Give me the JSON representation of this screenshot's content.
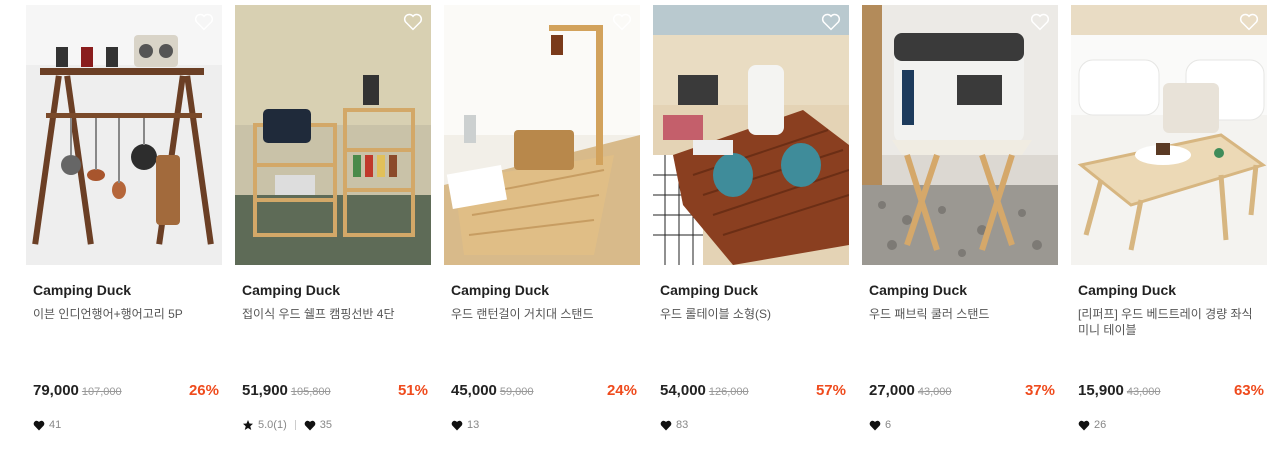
{
  "products": [
    {
      "brand": "Camping Duck",
      "title": "이븐 인디언행어+행어고리 5P",
      "price": "79,000",
      "original_price": "107,000",
      "discount": "26%",
      "likes": "41",
      "rating": null,
      "image": "wood-hanger-rack-with-lanterns-and-cookware"
    },
    {
      "brand": "Camping Duck",
      "title": "접이식 우드 쉘프 캠핑선반 4단",
      "price": "51,900",
      "original_price": "105,800",
      "discount": "51%",
      "likes": "35",
      "rating": "5.0(1)",
      "image": "folding-wood-shelves-outdoors"
    },
    {
      "brand": "Camping Duck",
      "title": "우드 랜턴걸이 거치대 스탠드",
      "price": "45,000",
      "original_price": "59,000",
      "discount": "24%",
      "likes": "13",
      "rating": null,
      "image": "wood-lantern-stand-on-table"
    },
    {
      "brand": "Camping Duck",
      "title": "우드 롤테이블 소형(S)",
      "price": "54,000",
      "original_price": "126,000",
      "discount": "57%",
      "likes": "83",
      "rating": null,
      "image": "wood-roll-table-on-beach"
    },
    {
      "brand": "Camping Duck",
      "title": "우드 패브릭 쿨러 스탠드",
      "price": "27,000",
      "original_price": "43,000",
      "discount": "37%",
      "likes": "6",
      "rating": null,
      "image": "cooler-on-fabric-stand"
    },
    {
      "brand": "Camping Duck",
      "title": "[리퍼프] 우드 베드트레이 경량 좌식 미니 테이블",
      "price": "15,900",
      "original_price": "43,000",
      "discount": "63%",
      "likes": "26",
      "rating": null,
      "image": "wood-bed-tray-on-bed"
    }
  ],
  "icons": {
    "wishlist": "heart-outline-icon",
    "likes": "heart-filled-icon",
    "rating": "star-filled-icon"
  },
  "colors": {
    "discount": "#ef4b1d",
    "text": "#222222",
    "muted": "#888888"
  }
}
